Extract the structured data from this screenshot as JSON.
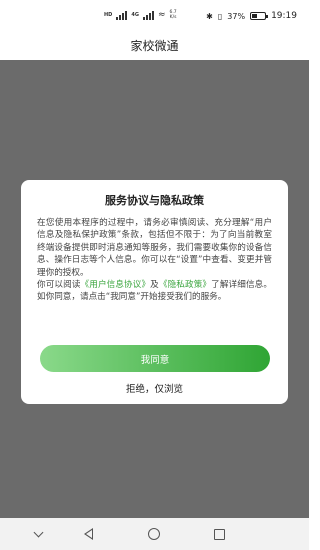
{
  "status_bar": {
    "carrier1": "HD",
    "carrier2": "4G",
    "speed_value": "6.7",
    "speed_unit": "K/s",
    "battery_percent": "37%",
    "battery_level": 0.37,
    "time": "19:19"
  },
  "header": {
    "title": "家校微通"
  },
  "dialog": {
    "title": "服务协议与隐私政策",
    "para1": "在您使用本程序的过程中，请务必审慎阅读、充分理解“用户信息及隐私保护政策”条款，包括但不限于：为了向当前教室终端设备提供即时消息通知等服务，我们需要收集你的设备信息、操作日志等个人信息。你可以在“设置”中查看、变更并管理你的授权。",
    "para2_prefix": "你可以阅读",
    "user_agreement_link": "《用户信息协议》",
    "and": "及",
    "privacy_policy_link": "《隐私政策》",
    "para2_suffix": "了解详细信息。如你同意，请点击“我同意”开始接受我们的服务。",
    "agree_label": "我同意",
    "decline_label": "拒绝，仅浏览",
    "agree_gradient_start": "#8ad98a",
    "agree_gradient_end": "#2fa534",
    "link_color": "#3aa53e"
  },
  "nav_bar": {
    "buttons": [
      "chevron-down-icon",
      "back-icon",
      "home-icon",
      "recent-apps-icon"
    ]
  }
}
